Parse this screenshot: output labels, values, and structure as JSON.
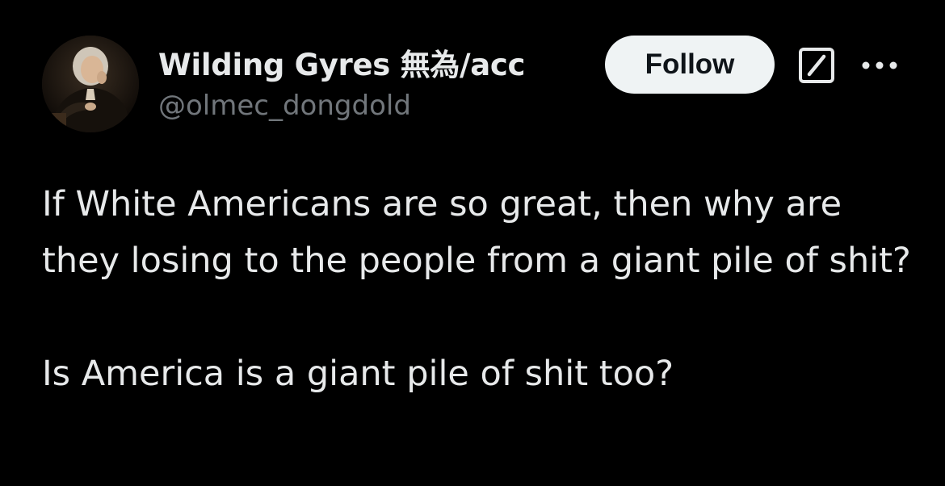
{
  "author": {
    "display_name": "Wilding Gyres 無為/acc",
    "handle": "@olmec_dongdold",
    "avatar_icon": "portrait-avatar"
  },
  "actions": {
    "follow_label": "Follow",
    "grok_icon": "grok-icon",
    "more_icon": "more-dots-icon"
  },
  "tweet": {
    "text": "If White Americans are so great, then why are they losing to the people from a giant pile of shit?\n\nIs America is a giant pile of shit too?"
  },
  "colors": {
    "background": "#000000",
    "primary_text": "#e7e9ea",
    "secondary_text": "#71767b",
    "follow_bg": "#eff3f4",
    "follow_text": "#0f1419"
  }
}
